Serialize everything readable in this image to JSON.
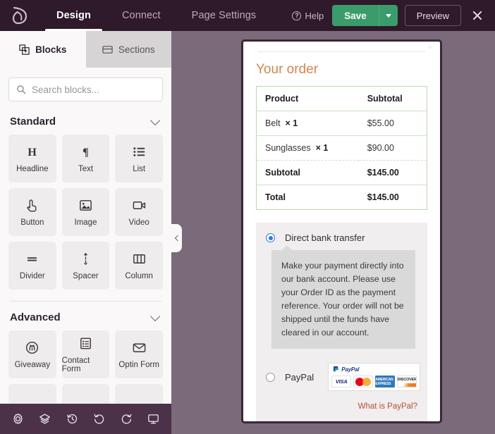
{
  "topbar": {
    "logo_icon": "leaf-logo-icon",
    "nav_items": [
      {
        "label": "Design",
        "active": true
      },
      {
        "label": "Connect",
        "active": false
      },
      {
        "label": "Page Settings",
        "active": false
      }
    ],
    "help_label": "Help",
    "help_icon": "question-circle-icon",
    "save_label": "Save",
    "save_caret_icon": "chevron-down-icon",
    "preview_label": "Preview",
    "close_icon": "close-icon",
    "bar_color": "#2e1a2a",
    "save_color": "#3b9c6b"
  },
  "sidebar": {
    "tabs": [
      {
        "label": "Blocks",
        "icon": "blocks-icon",
        "active": true
      },
      {
        "label": "Sections",
        "icon": "sections-icon",
        "active": false
      }
    ],
    "search": {
      "placeholder": "Search blocks...",
      "value": "",
      "icon": "search-icon"
    },
    "groups": [
      {
        "title": "Standard",
        "chevron_icon": "chevron-down-icon",
        "blocks": [
          {
            "label": "Headline",
            "icon": "headline-icon"
          },
          {
            "label": "Text",
            "icon": "paragraph-icon"
          },
          {
            "label": "List",
            "icon": "list-icon"
          },
          {
            "label": "Button",
            "icon": "button-click-icon"
          },
          {
            "label": "Image",
            "icon": "image-icon"
          },
          {
            "label": "Video",
            "icon": "video-camera-icon"
          },
          {
            "label": "Divider",
            "icon": "divider-icon"
          },
          {
            "label": "Spacer",
            "icon": "spacer-arrows-icon"
          },
          {
            "label": "Column",
            "icon": "column-icon"
          }
        ]
      },
      {
        "title": "Advanced",
        "chevron_icon": "chevron-down-icon",
        "blocks": [
          {
            "label": "Giveaway",
            "icon": "giveaway-trophy-icon"
          },
          {
            "label": "Contact Form",
            "icon": "contact-form-icon"
          },
          {
            "label": "Optin Form",
            "icon": "envelope-icon"
          }
        ]
      }
    ],
    "collapse_icon": "chevron-left-icon",
    "bottom_toolbar": [
      {
        "icon": "gear-icon",
        "name": "settings"
      },
      {
        "icon": "layers-icon",
        "name": "layers"
      },
      {
        "icon": "history-clock-icon",
        "name": "revision-history"
      },
      {
        "icon": "undo-icon",
        "name": "undo"
      },
      {
        "icon": "redo-icon",
        "name": "redo"
      },
      {
        "icon": "monitor-icon",
        "name": "device-preview"
      }
    ]
  },
  "canvas": {
    "background_color": "#7b6a79",
    "drag_mark": "⁘",
    "order": {
      "title": "Your order",
      "title_color": "#d2854f",
      "headers": {
        "product": "Product",
        "subtotal": "Subtotal"
      },
      "rows": [
        {
          "name": "Belt",
          "qty": "× 1",
          "amount": "$55.00"
        },
        {
          "name": "Sunglasses",
          "qty": "× 1",
          "amount": "$90.00"
        }
      ],
      "totals": [
        {
          "label": "Subtotal",
          "amount": "$145.00"
        },
        {
          "label": "Total",
          "amount": "$145.00"
        }
      ]
    },
    "payment": {
      "options": [
        {
          "label": "Direct bank transfer",
          "selected": true,
          "description": "Make your payment directly into our bank account. Please use your Order ID as the payment reference. Your order will not be shipped until the funds have cleared in our account."
        },
        {
          "label": "PayPal",
          "selected": false
        }
      ],
      "cards": [
        {
          "name": "visa-card-logo",
          "text": "VISA"
        },
        {
          "name": "mastercard-logo",
          "text": ""
        },
        {
          "name": "amex-card-logo",
          "text": "AMERICAN EXPRESS"
        },
        {
          "name": "discover-card-logo",
          "text": "DISCOVER"
        }
      ],
      "paypal_brand": "PayPal",
      "help_link": "What is PayPal?",
      "help_link_color": "#b8503c",
      "radio_selected_color": "#2a7ae2"
    }
  }
}
